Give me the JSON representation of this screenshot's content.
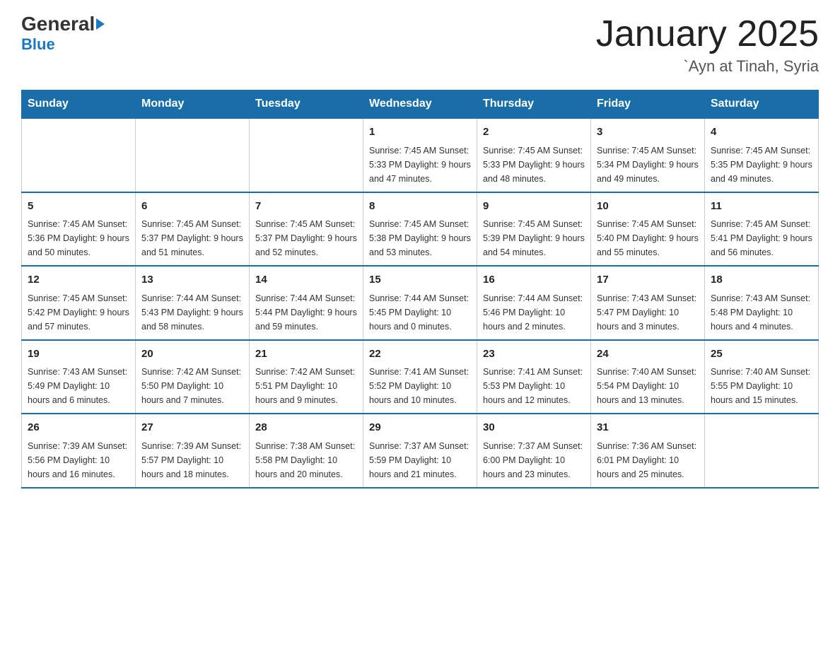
{
  "logo": {
    "general": "General",
    "blue": "Blue",
    "arrow": "▶"
  },
  "title": "January 2025",
  "subtitle": "`Ayn at Tinah, Syria",
  "headers": [
    "Sunday",
    "Monday",
    "Tuesday",
    "Wednesday",
    "Thursday",
    "Friday",
    "Saturday"
  ],
  "weeks": [
    [
      {
        "day": "",
        "info": ""
      },
      {
        "day": "",
        "info": ""
      },
      {
        "day": "",
        "info": ""
      },
      {
        "day": "1",
        "info": "Sunrise: 7:45 AM\nSunset: 5:33 PM\nDaylight: 9 hours and 47 minutes."
      },
      {
        "day": "2",
        "info": "Sunrise: 7:45 AM\nSunset: 5:33 PM\nDaylight: 9 hours and 48 minutes."
      },
      {
        "day": "3",
        "info": "Sunrise: 7:45 AM\nSunset: 5:34 PM\nDaylight: 9 hours and 49 minutes."
      },
      {
        "day": "4",
        "info": "Sunrise: 7:45 AM\nSunset: 5:35 PM\nDaylight: 9 hours and 49 minutes."
      }
    ],
    [
      {
        "day": "5",
        "info": "Sunrise: 7:45 AM\nSunset: 5:36 PM\nDaylight: 9 hours and 50 minutes."
      },
      {
        "day": "6",
        "info": "Sunrise: 7:45 AM\nSunset: 5:37 PM\nDaylight: 9 hours and 51 minutes."
      },
      {
        "day": "7",
        "info": "Sunrise: 7:45 AM\nSunset: 5:37 PM\nDaylight: 9 hours and 52 minutes."
      },
      {
        "day": "8",
        "info": "Sunrise: 7:45 AM\nSunset: 5:38 PM\nDaylight: 9 hours and 53 minutes."
      },
      {
        "day": "9",
        "info": "Sunrise: 7:45 AM\nSunset: 5:39 PM\nDaylight: 9 hours and 54 minutes."
      },
      {
        "day": "10",
        "info": "Sunrise: 7:45 AM\nSunset: 5:40 PM\nDaylight: 9 hours and 55 minutes."
      },
      {
        "day": "11",
        "info": "Sunrise: 7:45 AM\nSunset: 5:41 PM\nDaylight: 9 hours and 56 minutes."
      }
    ],
    [
      {
        "day": "12",
        "info": "Sunrise: 7:45 AM\nSunset: 5:42 PM\nDaylight: 9 hours and 57 minutes."
      },
      {
        "day": "13",
        "info": "Sunrise: 7:44 AM\nSunset: 5:43 PM\nDaylight: 9 hours and 58 minutes."
      },
      {
        "day": "14",
        "info": "Sunrise: 7:44 AM\nSunset: 5:44 PM\nDaylight: 9 hours and 59 minutes."
      },
      {
        "day": "15",
        "info": "Sunrise: 7:44 AM\nSunset: 5:45 PM\nDaylight: 10 hours and 0 minutes."
      },
      {
        "day": "16",
        "info": "Sunrise: 7:44 AM\nSunset: 5:46 PM\nDaylight: 10 hours and 2 minutes."
      },
      {
        "day": "17",
        "info": "Sunrise: 7:43 AM\nSunset: 5:47 PM\nDaylight: 10 hours and 3 minutes."
      },
      {
        "day": "18",
        "info": "Sunrise: 7:43 AM\nSunset: 5:48 PM\nDaylight: 10 hours and 4 minutes."
      }
    ],
    [
      {
        "day": "19",
        "info": "Sunrise: 7:43 AM\nSunset: 5:49 PM\nDaylight: 10 hours and 6 minutes."
      },
      {
        "day": "20",
        "info": "Sunrise: 7:42 AM\nSunset: 5:50 PM\nDaylight: 10 hours and 7 minutes."
      },
      {
        "day": "21",
        "info": "Sunrise: 7:42 AM\nSunset: 5:51 PM\nDaylight: 10 hours and 9 minutes."
      },
      {
        "day": "22",
        "info": "Sunrise: 7:41 AM\nSunset: 5:52 PM\nDaylight: 10 hours and 10 minutes."
      },
      {
        "day": "23",
        "info": "Sunrise: 7:41 AM\nSunset: 5:53 PM\nDaylight: 10 hours and 12 minutes."
      },
      {
        "day": "24",
        "info": "Sunrise: 7:40 AM\nSunset: 5:54 PM\nDaylight: 10 hours and 13 minutes."
      },
      {
        "day": "25",
        "info": "Sunrise: 7:40 AM\nSunset: 5:55 PM\nDaylight: 10 hours and 15 minutes."
      }
    ],
    [
      {
        "day": "26",
        "info": "Sunrise: 7:39 AM\nSunset: 5:56 PM\nDaylight: 10 hours and 16 minutes."
      },
      {
        "day": "27",
        "info": "Sunrise: 7:39 AM\nSunset: 5:57 PM\nDaylight: 10 hours and 18 minutes."
      },
      {
        "day": "28",
        "info": "Sunrise: 7:38 AM\nSunset: 5:58 PM\nDaylight: 10 hours and 20 minutes."
      },
      {
        "day": "29",
        "info": "Sunrise: 7:37 AM\nSunset: 5:59 PM\nDaylight: 10 hours and 21 minutes."
      },
      {
        "day": "30",
        "info": "Sunrise: 7:37 AM\nSunset: 6:00 PM\nDaylight: 10 hours and 23 minutes."
      },
      {
        "day": "31",
        "info": "Sunrise: 7:36 AM\nSunset: 6:01 PM\nDaylight: 10 hours and 25 minutes."
      },
      {
        "day": "",
        "info": ""
      }
    ]
  ]
}
